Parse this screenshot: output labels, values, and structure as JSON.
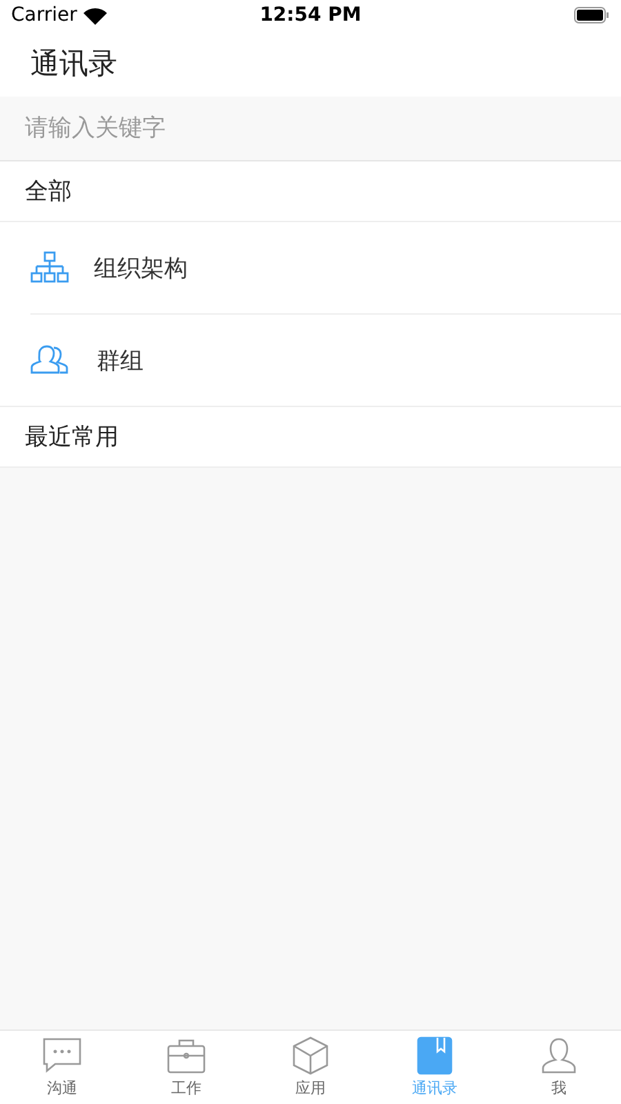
{
  "status_bar": {
    "carrier": "Carrier",
    "time": "12:54 PM"
  },
  "title": "通讯录",
  "search": {
    "placeholder": "请输入关键字"
  },
  "sections": [
    {
      "header": "全部",
      "items": [
        {
          "kind": "org",
          "label": "组织架构"
        },
        {
          "kind": "group",
          "label": "群组"
        }
      ]
    },
    {
      "header": "最近常用"
    }
  ],
  "tabs": [
    {
      "kind": "chat",
      "label": "沟通",
      "selected": false
    },
    {
      "kind": "work",
      "label": "工作",
      "selected": false
    },
    {
      "kind": "apps",
      "label": "应用",
      "selected": false
    },
    {
      "kind": "contacts",
      "label": "通讯录",
      "selected": true
    },
    {
      "kind": "me",
      "label": "我",
      "selected": false
    }
  ]
}
